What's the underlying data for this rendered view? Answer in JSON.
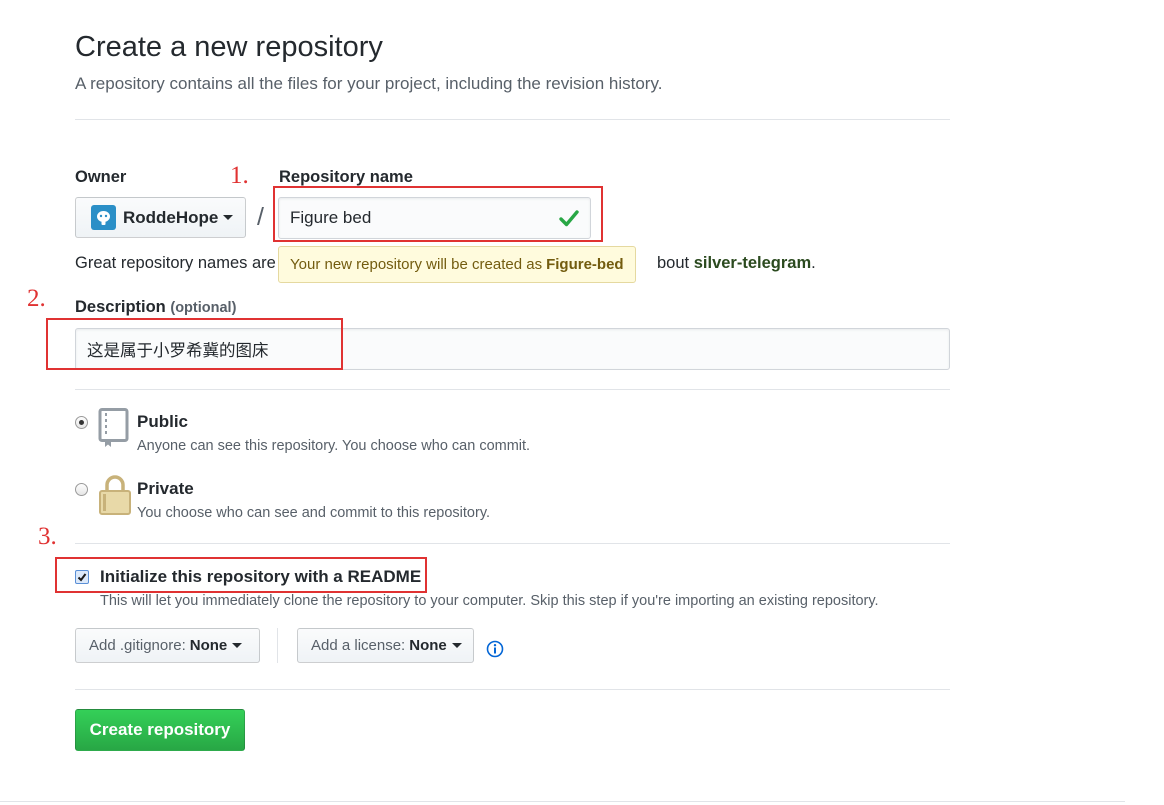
{
  "header": {
    "title": "Create a new repository",
    "subtitle": "A repository contains all the files for your project, including the revision history."
  },
  "owner": {
    "label": "Owner",
    "name": "RoddeHope",
    "avatar_icon": "octocat-avatar-icon"
  },
  "repo": {
    "label": "Repository name",
    "value": "Figure bed",
    "valid_icon": "check-icon",
    "separator": "/",
    "tooltip_prefix": "Your new repository will be created as",
    "tooltip_name": "Figure-bed",
    "hint_start": "Great repository names are",
    "hint_tail_prefix": "bout",
    "hint_suggestion": "silver-telegram",
    "hint_end": "."
  },
  "description": {
    "label": "Description",
    "optional": "(optional)",
    "value": "这是属于小罗希冀的图床"
  },
  "visibility": {
    "public": {
      "title": "Public",
      "note": "Anyone can see this repository. You choose who can commit.",
      "icon": "repo-book-icon",
      "selected": true
    },
    "private": {
      "title": "Private",
      "note": "You choose who can see and commit to this repository.",
      "icon": "lock-icon",
      "selected": false
    }
  },
  "init": {
    "label": "Initialize this repository with a README",
    "note": "This will let you immediately clone the repository to your computer. Skip this step if you're importing an existing repository.",
    "checked": true
  },
  "options": {
    "gitignore_label": "Add .gitignore:",
    "gitignore_value": "None",
    "license_label": "Add a license:",
    "license_value": "None",
    "info_icon": "info-icon"
  },
  "submit": {
    "label": "Create repository",
    "color": "#28a745"
  },
  "annotations": {
    "step1": "1.",
    "step2": "2.",
    "step3": "3.",
    "color": "#e03232"
  }
}
